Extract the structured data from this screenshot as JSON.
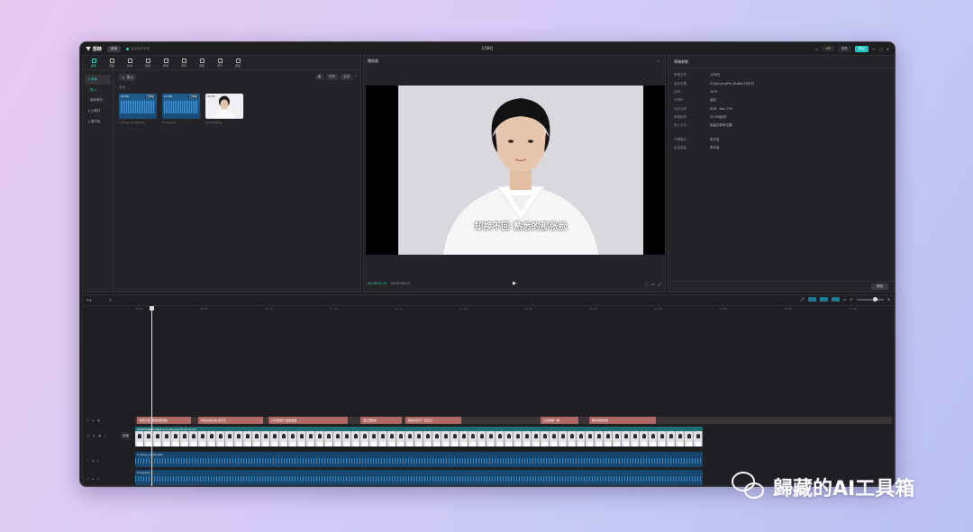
{
  "titlebar": {
    "app_name": "剪映",
    "menu": "菜单",
    "autosave": "自动保存本地",
    "project": "1月8日",
    "vip": "VIP",
    "publish": "发布",
    "export": "导出"
  },
  "toolbar_tabs": [
    {
      "label": "媒体",
      "icon": "media-icon"
    },
    {
      "label": "音频",
      "icon": "audio-icon"
    },
    {
      "label": "文本",
      "icon": "text-icon"
    },
    {
      "label": "贴纸",
      "icon": "sticker-icon"
    },
    {
      "label": "特效",
      "icon": "effects-icon"
    },
    {
      "label": "转场",
      "icon": "transition-icon"
    },
    {
      "label": "滤镜",
      "icon": "filter-icon"
    },
    {
      "label": "调节",
      "icon": "adjust-icon"
    },
    {
      "label": "模板",
      "icon": "template-icon"
    }
  ],
  "side_nav": {
    "local": "本地",
    "import": "导入",
    "library_sub": "媒体素材",
    "cloud": "云素材",
    "library": "素材库"
  },
  "media": {
    "import_label": "导入",
    "section_label": "本地",
    "filter_all": "全部",
    "sort": "排序",
    "thumbs": [
      {
        "type": "audio",
        "duration": "11:0X",
        "added": "已添加",
        "name": "1_Song_vocals.wav"
      },
      {
        "type": "audio",
        "duration": "11:0X",
        "added": "已添加",
        "name": "Song.wav"
      },
      {
        "type": "photo",
        "duration": "00:05",
        "added": "",
        "name": "portrait.png"
      }
    ]
  },
  "player": {
    "title": "播放器",
    "subtitle": "却换不回 熟悉的那张脸",
    "current_time": "00:00:01:19",
    "total_time": "00:05:43:23"
  },
  "props": {
    "title": "草稿参数",
    "rows": [
      {
        "key": "草稿名称",
        "val": "1月8日"
      },
      {
        "key": "保存位置",
        "val": "D:/JianyingPro Drafts/1月8日"
      },
      {
        "key": "比例",
        "val": "16:9"
      },
      {
        "key": "分辨率",
        "val": "适应"
      },
      {
        "key": "色彩空间",
        "val": "SDR - Rec.709"
      },
      {
        "key": "草稿帧率",
        "val": "30.00帧/秒"
      },
      {
        "key": "导入方式",
        "val": "保留在原有位置"
      }
    ],
    "rows2": [
      {
        "key": "代理模式",
        "val": "未开启"
      },
      {
        "key": "自由层级",
        "val": "未开启"
      }
    ],
    "modify": "修改"
  },
  "timeline": {
    "ruler": [
      "00:00",
      "00:20",
      "00:40",
      "01:00",
      "01:20",
      "01:40",
      "02:00",
      "02:20",
      "02:40",
      "03:00",
      "03:20",
      "03:40",
      "04:00"
    ],
    "cover": "封面",
    "video_label": "0bf2f5ef9a7c48e8 portrait.png  00:05:43:23",
    "audio1_label": "1_Song_vocals.wav",
    "audio2_label": "Song.wav",
    "text_clips": [
      "却换不回 熟悉的那张脸",
      "时间过得太快 来不及",
      "只好把回忆 慢慢收藏",
      "回忆里的你",
      "那些年我们一起走过",
      "让我再看一看",
      "那张熟悉的脸"
    ]
  },
  "watermark": "歸藏的AI工具箱"
}
